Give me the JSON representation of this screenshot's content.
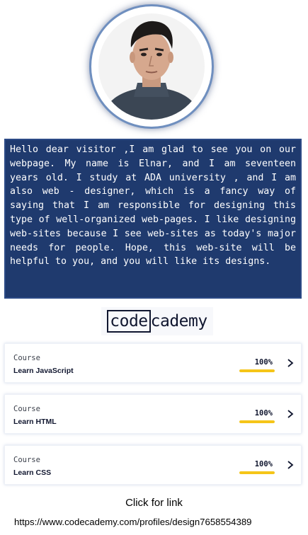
{
  "profile": {
    "photo_icon": "person-portrait-icon",
    "bio": "Hello dear visitor ,I am glad to see you on our webpage. My name is Elnar, and I am seventeen years old. I study at ADA university , and I am also web - designer, which is a fancy way of saying that I am responsible for designing this type of well-organized web-pages. I like designing web-sites because I see web-sites as today's major needs for people. Hope, this web-site will be helpful to you, and you will like its designs."
  },
  "logo": {
    "part1": "code",
    "part2": "cademy"
  },
  "courses": [
    {
      "kind": "Course",
      "name": "Learn JavaScript",
      "progress_label": "100%",
      "progress": 1.0
    },
    {
      "kind": "Course",
      "name": "Learn HTML",
      "progress_label": "100%",
      "progress": 1.0
    },
    {
      "kind": "Course",
      "name": "Learn CSS",
      "progress_label": "100%",
      "progress": 1.0
    }
  ],
  "link": {
    "caption": "Click for link",
    "url": "https://www.codecademy.com/profiles/design7658554389"
  },
  "colors": {
    "bio_background": "#1f3a6e",
    "progress_fill": "#f5c518",
    "ring_border": "#6f8fbf"
  }
}
